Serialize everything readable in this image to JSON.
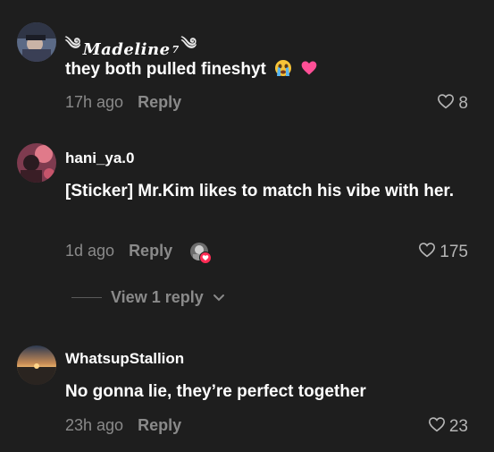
{
  "comments": [
    {
      "username": "Madeline",
      "username_suffix": "7",
      "text": "they both pulled fineshyt",
      "emoji": [
        "crying-face",
        "pink-heart"
      ],
      "time": "17h ago",
      "reply_label": "Reply",
      "likes": "8",
      "creator_liked": false
    },
    {
      "username": "hani_ya.0",
      "text": "[Sticker] Mr.Kim likes to match his vibe with her.",
      "time": "1d ago",
      "reply_label": "Reply",
      "likes": "175",
      "creator_liked": true,
      "view_replies_label": "View 1 reply"
    },
    {
      "username": "WhatsupStallion",
      "text": "No gonna lie, they’re perfect together",
      "time": "23h ago",
      "reply_label": "Reply",
      "likes": "23",
      "creator_liked": false
    }
  ],
  "colors": {
    "background": "#1e1e1e",
    "primary_text": "#ffffff",
    "secondary_text": "#8a8a8a",
    "like_badge": "#fe2c55"
  }
}
